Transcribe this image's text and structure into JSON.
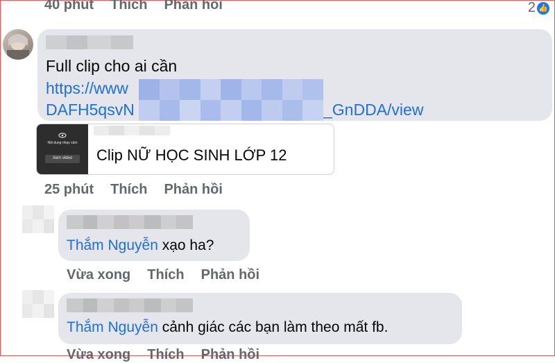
{
  "top_actions": {
    "time": "40 phút",
    "like": "Thích",
    "reply": "Phản hồi"
  },
  "top_reactions": {
    "count": "2"
  },
  "comment1": {
    "text": "Full clip cho ai cần",
    "link_line1": "https://www",
    "link_line2_start": "DAFH5qsvN",
    "link_line2_end": "_GnDDA/view",
    "preview_title": "Clip NỮ HỌC SINH LỚP 12",
    "thumb_warning_title": "Nội dung nhạy cảm",
    "thumb_button": "Xem video"
  },
  "comment1_actions": {
    "time": "25 phút",
    "like": "Thích",
    "reply": "Phản hồi"
  },
  "reply1": {
    "mention": "Thắm Nguyễn",
    "text": " xạo ha?"
  },
  "reply1_actions": {
    "time": "Vừa xong",
    "like": "Thích",
    "reply": "Phản hồi"
  },
  "reply2": {
    "mention": "Thắm Nguyễn",
    "text": " cảnh giác các bạn làm theo mất fb."
  },
  "reply2_actions": {
    "time": "Vừa xong",
    "like": "Thích",
    "reply": "Phản hồi"
  },
  "colors": {
    "bubble": "#e4e6eb",
    "link": "#216fdb",
    "muted": "#65676b",
    "frame": "#e05a5a"
  }
}
